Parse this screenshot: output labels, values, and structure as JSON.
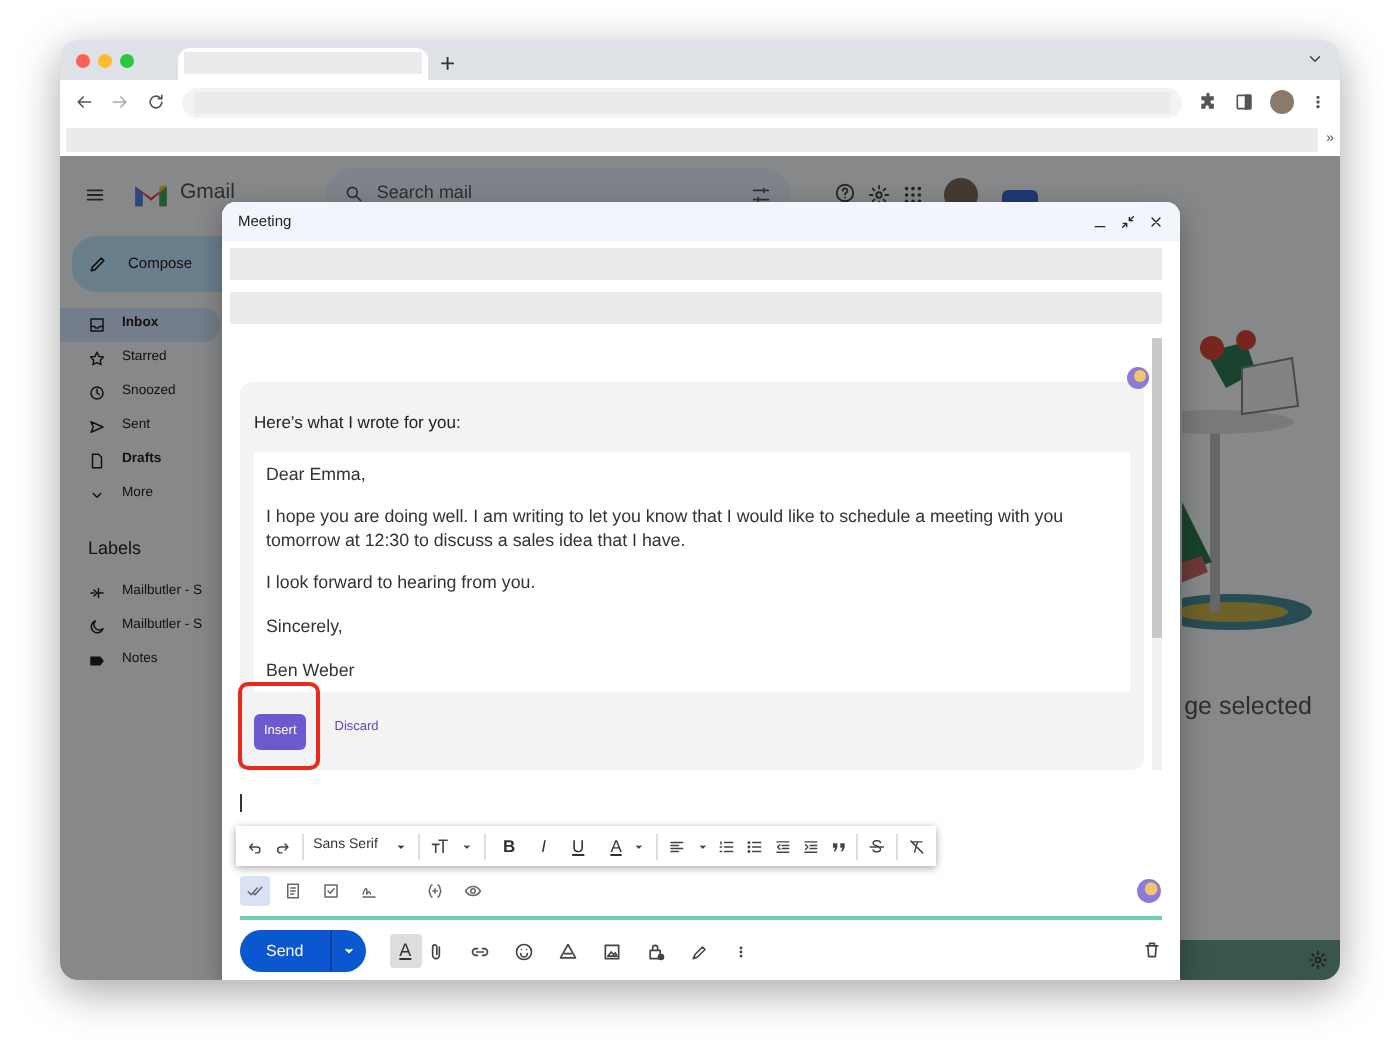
{
  "browser": {
    "new_tab": "+",
    "bookmarks_more": "»"
  },
  "gmail": {
    "app_name": "Gmail",
    "search_placeholder": "Search mail",
    "compose_button": "Compose",
    "nav": [
      {
        "label": "Inbox",
        "selected": true,
        "bold": true
      },
      {
        "label": "Starred",
        "selected": false,
        "bold": false
      },
      {
        "label": "Snoozed",
        "selected": false,
        "bold": false
      },
      {
        "label": "Sent",
        "selected": false,
        "bold": false
      },
      {
        "label": "Drafts",
        "selected": false,
        "bold": true
      },
      {
        "label": "More",
        "selected": false,
        "bold": false
      }
    ],
    "labels_heading": "Labels",
    "labels": [
      {
        "label": "Mailbutler - S"
      },
      {
        "label": "Mailbutler - S"
      },
      {
        "label": "Notes"
      }
    ],
    "empty_text": "ge selected"
  },
  "compose": {
    "title": "Meeting",
    "ai_panel": {
      "heading": "Here’s what I wrote for you:",
      "paragraphs": [
        "Dear Emma,",
        "I hope you are doing well. I am writing to let you know that I would like to schedule a meeting with you tomorrow at 12:30 to discuss a sales idea that I have.",
        "I look forward to hearing from you.",
        "Sincerely,",
        "Ben Weber"
      ],
      "insert": {
        "label": "Insert",
        "highlighted": true
      },
      "discard": "Discard"
    },
    "format_toolbar": {
      "font": "Sans Serif",
      "bold": "B",
      "italic": "I",
      "underline": "U",
      "text_color": "A"
    },
    "tool_row": [
      {
        "on": true
      },
      {
        "on": false
      },
      {
        "on": false
      },
      {
        "on": false
      },
      {
        "on": false
      },
      {
        "on": false
      }
    ],
    "send": "Send",
    "format_toggle": {
      "label": "A",
      "on": true
    }
  }
}
